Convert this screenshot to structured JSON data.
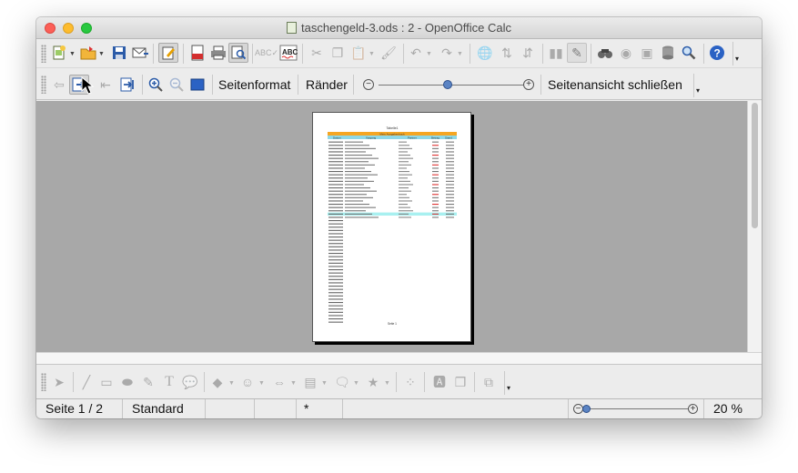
{
  "window": {
    "title": "taschengeld-3.ods : 2 - OpenOffice Calc",
    "traffic_lights": [
      "close",
      "minimize",
      "zoom"
    ]
  },
  "standard_toolbar": {
    "icons": [
      "new-document-icon",
      "open-folder-icon",
      "save-icon",
      "email-icon",
      "edit-file-icon",
      "export-pdf-icon",
      "print-icon",
      "page-preview-icon",
      "spellcheck-icon",
      "autospellcheck-icon",
      "cut-icon",
      "copy-icon",
      "paste-icon",
      "clone-formatting-icon",
      "undo-icon",
      "redo-icon",
      "hyperlink-icon",
      "sort-ascending-icon",
      "sort-descending-icon",
      "chart-icon",
      "draw-functions-icon",
      "find-replace-icon",
      "navigator-icon",
      "gallery-icon",
      "data-sources-icon",
      "zoom-icon",
      "help-icon"
    ]
  },
  "preview_toolbar": {
    "page_format_label": "Seitenformat",
    "margins_label": "Ränder",
    "close_preview_label": "Seitenansicht schließen",
    "icons": [
      "previous-page-icon",
      "next-page-icon",
      "first-page-icon",
      "last-page-icon",
      "zoom-in-icon",
      "zoom-out-icon",
      "full-screen-icon"
    ]
  },
  "page_preview": {
    "header_text": "Tabelle1",
    "table_title": "Mein Ausgabenbuch",
    "columns": [
      "Datum",
      "Vorgang",
      "Partner",
      "Betrag",
      "Stand"
    ],
    "footer_text": "Seite 1",
    "accent_color": "#f5a623",
    "header_row_color": "#8ed8e8",
    "highlight_row_color": "#a8f0f0"
  },
  "drawing_toolbar": {
    "icons": [
      "select-arrow-icon",
      "line-icon",
      "rectangle-icon",
      "ellipse-icon",
      "freeform-icon",
      "text-icon",
      "callout-icon",
      "basic-shapes-icon",
      "symbol-shapes-icon",
      "block-arrows-icon",
      "flowchart-icon",
      "callouts-icon",
      "stars-icon",
      "points-icon",
      "fontwork-icon",
      "extrusion-icon",
      "align-icon"
    ]
  },
  "status_bar": {
    "page_info": "Seite 1 / 2",
    "page_style": "Standard",
    "modified_indicator": "*",
    "zoom_percent": "20 %"
  }
}
